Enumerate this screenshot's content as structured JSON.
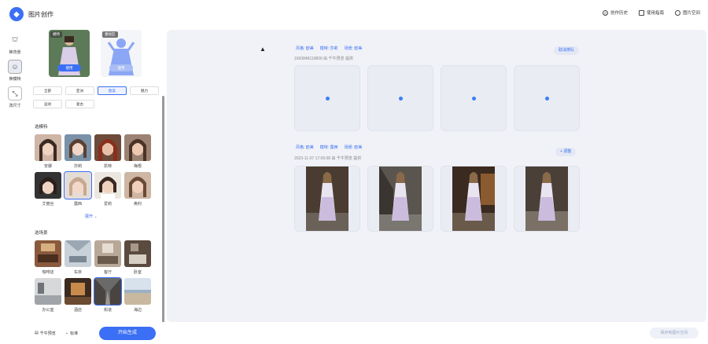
{
  "app": {
    "title": "图片创作",
    "logo_icon": "logo-icon"
  },
  "top_actions": [
    {
      "label": "创作历史",
      "icon": "history-icon"
    },
    {
      "label": "使用指南",
      "icon": "guide-icon"
    },
    {
      "label": "图片空间",
      "icon": "space-icon"
    }
  ],
  "rail": [
    {
      "label": "换背景",
      "icon": "background-icon",
      "active": false
    },
    {
      "label": "换模特",
      "icon": "model-icon",
      "active": true
    },
    {
      "label": "改尺寸",
      "icon": "resize-icon",
      "active": false
    }
  ],
  "templates": [
    {
      "tag": "模特",
      "button": "使用"
    },
    {
      "tag": "重绘区",
      "button": "使用"
    }
  ],
  "style_chips": [
    "全部",
    "亚洲",
    "欧美",
    "魅力",
    "运动",
    "复古"
  ],
  "selected_chip": "欧美",
  "model_section": {
    "title": "选模特",
    "items": [
      "安娜",
      "莎莉",
      "凯特",
      "梅根",
      "艾丽丝",
      "露西",
      "爱莉",
      "奥利"
    ],
    "selected": "露西",
    "expand": "展开"
  },
  "scene_section": {
    "title": "选场景",
    "items": [
      "咖啡店",
      "车床",
      "客厅",
      "卧室",
      "办公室",
      "酒店",
      "街道",
      "海边"
    ],
    "selected": "街道"
  },
  "footer": {
    "option1": "千牛预览",
    "option2": "标准",
    "generate": "开始生成"
  },
  "results": [
    {
      "tags": [
        "风格: 欧美",
        "模特: 莎莉",
        "场景: 欧美"
      ],
      "meta": "1693848119800 由 千牛预览 提供",
      "action": "取消排队",
      "state": "loading",
      "count": 4
    },
    {
      "tags": [
        "风格: 欧美",
        "模特: 露西",
        "场景: 欧美"
      ],
      "meta": "2023-11-07 17:06:08 由 千牛预览 提供",
      "action": "+ 调整",
      "state": "done",
      "count": 4
    }
  ],
  "save_button": "保存到图片空间",
  "colors": {
    "accent": "#3b6ff5",
    "panel_bg": "#f0f2f7"
  }
}
